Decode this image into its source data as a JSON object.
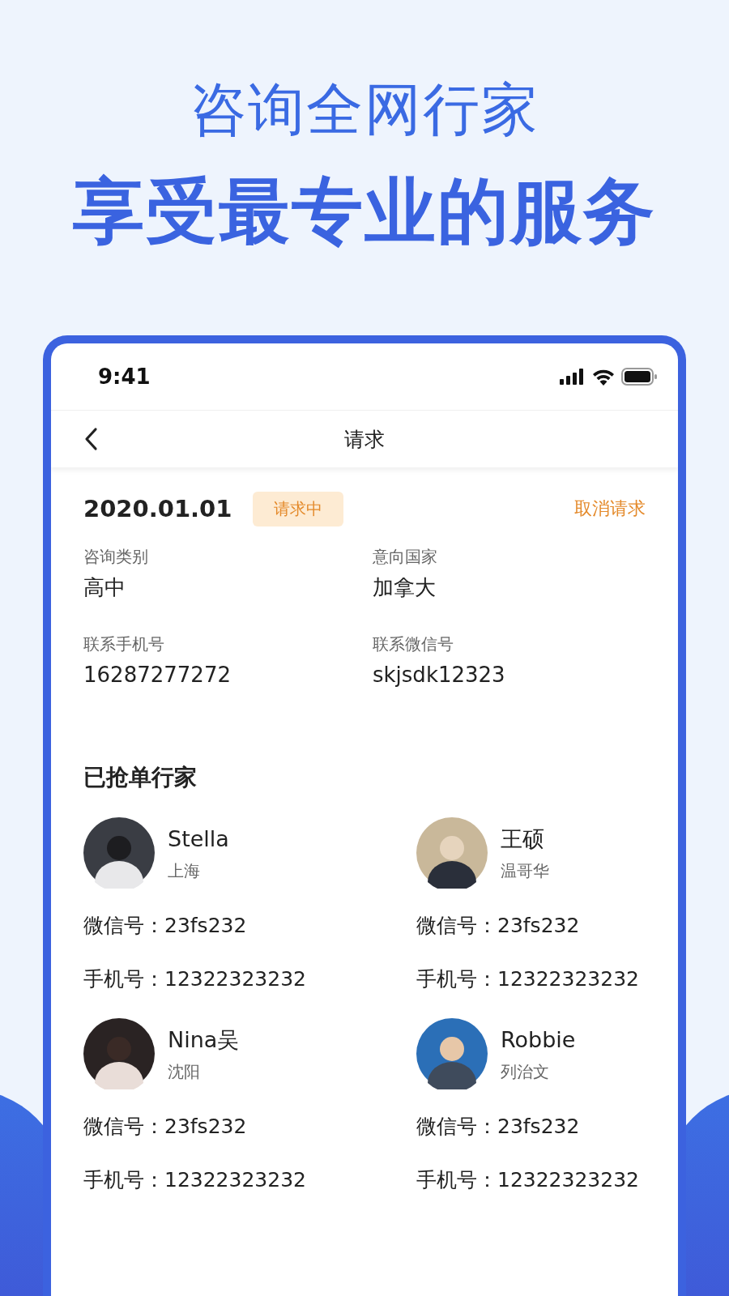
{
  "headline": {
    "line_1": "咨询全网行家",
    "line_2": "享受最专业的服务"
  },
  "status_bar": {
    "time": "9:41"
  },
  "nav": {
    "title": "请求"
  },
  "request": {
    "date": "2020.01.01",
    "status": "请求中",
    "action": "取消请求",
    "fields": [
      {
        "label": "咨询类别",
        "value": "高中"
      },
      {
        "label": "意向国家",
        "value": "加拿大"
      },
      {
        "label": "联系手机号",
        "value": "16287277272"
      },
      {
        "label": "联系微信号",
        "value": "skjsdk12323"
      }
    ]
  },
  "experts": {
    "title": "已抢单行家",
    "items": [
      {
        "name": "Stella",
        "city": "上海",
        "wechat": "微信号：23fs232",
        "phone": "手机号：12322323232"
      },
      {
        "name": "王硕",
        "city": "温哥华",
        "wechat": "微信号：23fs232",
        "phone": "手机号：12322323232"
      },
      {
        "name": "Nina吴",
        "city": "沈阳",
        "wechat": "微信号：23fs232",
        "phone": "手机号：12322323232"
      },
      {
        "name": "Robbie",
        "city": "列治文",
        "wechat": "微信号：23fs232",
        "phone": "手机号：12322323232"
      }
    ]
  }
}
